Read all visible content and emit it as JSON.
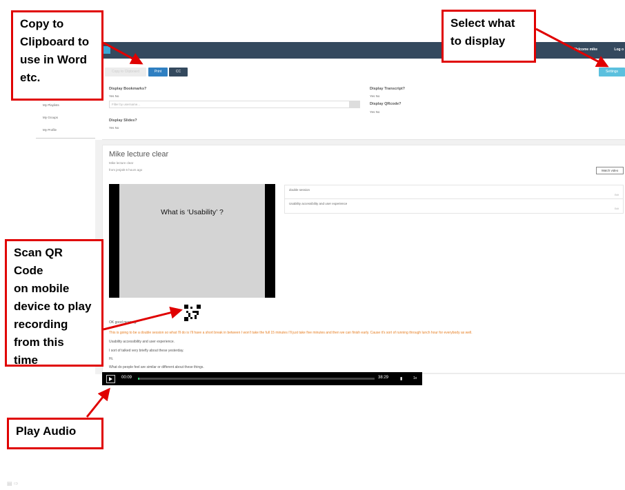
{
  "callouts": {
    "copy": "Copy to\nClipboard to\nuse in Word\netc.",
    "select": "Select what\nto display",
    "scan": "Scan QR Code\non mobile\ndevice to play\nrecording\nfrom this\ntime",
    "play": "Play Audio"
  },
  "header": {
    "welcome": "Welcome mike",
    "logout": "Log o"
  },
  "toolbar": {
    "copy_label": "Copy to Clipboard",
    "print_label": "Print",
    "cc_label": "CC",
    "settings_label": "Settings"
  },
  "settings": {
    "bookmarks_label": "Display Bookmarks?",
    "bookmarks_opts": "Yes No",
    "filter_placeholder": "Filter by username...",
    "slides_label": "Display Slides?",
    "slides_opts": "Yes No",
    "transcript_label": "Display Transcript?",
    "transcript_opts": "Yes No",
    "qr_label": "Display QRcode?",
    "qr_opts": "Yes No"
  },
  "sidebar": {
    "items": [
      "My Playlists",
      "My Groups",
      "My Profile"
    ]
  },
  "recording": {
    "title": "Mike lecture clear",
    "subtitle": "Mike lecture clear",
    "meta": "from jenjakt 6 hours ago",
    "watch_label": "Watch video",
    "slide_text": "What is ‘Usability’ ?"
  },
  "bookmarks": [
    {
      "text": "double session",
      "edit": "Edit"
    },
    {
      "text": "Usability accessibility and user experience",
      "edit": "Edit"
    }
  ],
  "transcript": {
    "lines": [
      {
        "text": "OK good morning.",
        "highlight": false
      },
      {
        "text": "This is going to be a double session so what I'll do is I'll have a short break in between I won't take the full 15 minutes I'll just take five minutes and then we can finish early. Cause it's sort of running through lunch hour for everybody as well.",
        "highlight": true
      },
      {
        "text": "Usability accessibility and user experience.",
        "highlight": false
      },
      {
        "text": "I sort of talked very briefly about these yesterday.",
        "highlight": false
      },
      {
        "text": "Hi.",
        "highlight": false
      },
      {
        "text": "What do people feel are similar or different about these things.",
        "highlight": false
      }
    ]
  },
  "player": {
    "current_time": "00:09",
    "duration": "38:29",
    "progress": 0.004,
    "speed": "1x"
  },
  "colors": {
    "callout_border": "#e00000",
    "header_bg": "#34495e",
    "highlight_text": "#e67e22",
    "progress_fill": "#2ecc71"
  }
}
